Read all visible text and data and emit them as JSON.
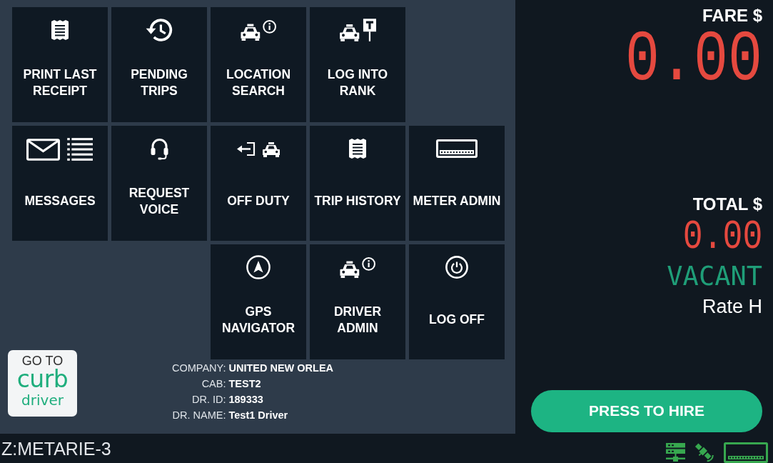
{
  "tile_rows": [
    [
      {
        "kind": "receipt",
        "label": "PRINT LAST RECEIPT"
      },
      {
        "kind": "history",
        "label": "PENDING TRIPS"
      },
      {
        "kind": "taxi-info",
        "label": "LOCATION SEARCH"
      },
      {
        "kind": "taxi-rank",
        "label": "LOG INTO RANK"
      }
    ],
    [
      {
        "kind": "messages",
        "label": "MESSAGES"
      },
      {
        "kind": "headset",
        "label": "REQUEST VOICE"
      },
      {
        "kind": "off-duty",
        "label": "OFF DUTY"
      },
      {
        "kind": "receipt",
        "label": "TRIP HISTORY"
      },
      {
        "kind": "meter",
        "label": "METER ADMIN"
      }
    ],
    [
      {
        "kind": "navigation",
        "label": "GPS NAVIGATOR"
      },
      {
        "kind": "taxi-info",
        "label": "DRIVER ADMIN"
      },
      {
        "kind": "power",
        "label": "LOG OFF"
      }
    ]
  ],
  "curb_button": {
    "line_1": "GO TO",
    "logo": "curb",
    "line_2": "driver"
  },
  "driver_info": [
    {
      "label": "COMPANY:",
      "value": "UNITED NEW ORLEA"
    },
    {
      "label": "CAB:",
      "value": "TEST2"
    },
    {
      "label": "DR. ID:",
      "value": "189333"
    },
    {
      "label": "DR. NAME:",
      "value": "Test1 Driver"
    }
  ],
  "status_bar": {
    "zone": "Z:METARIE-3"
  },
  "meter": {
    "fare_label": "FARE $",
    "fare": "0.00",
    "total_label": "TOTAL $",
    "total": "0.00",
    "status": "VACANT",
    "rate": "Rate H"
  },
  "hire_button": {
    "label": "PRESS TO HIRE"
  }
}
